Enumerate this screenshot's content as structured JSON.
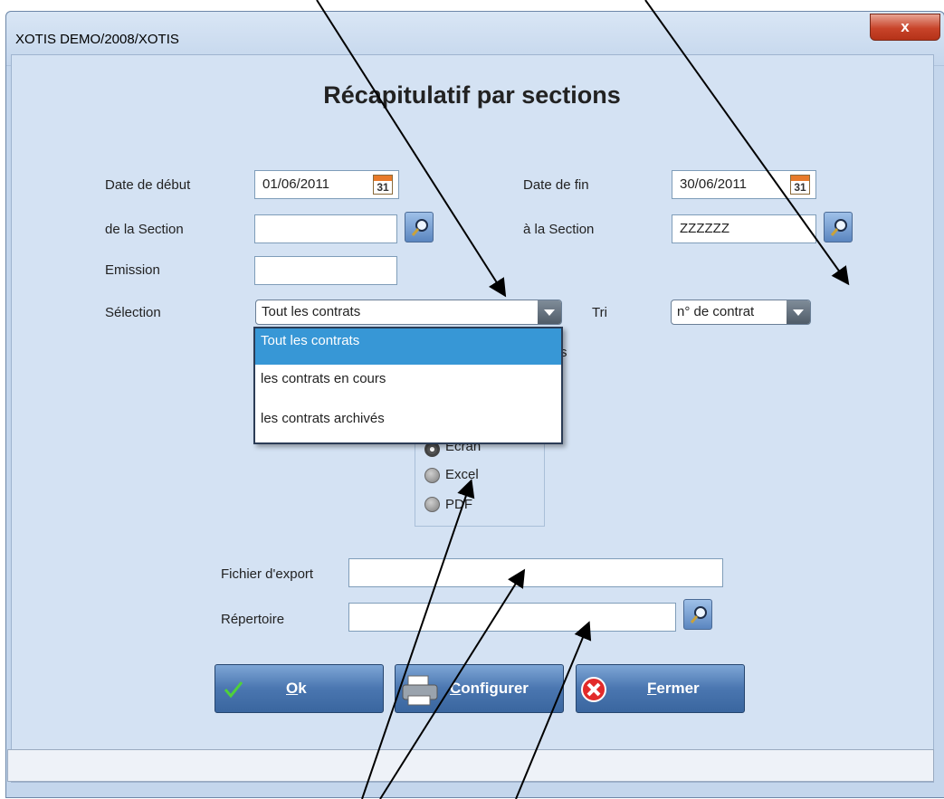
{
  "window": {
    "title": "XOTIS DEMO/2008/XOTIS",
    "close_label": "x"
  },
  "heading": "Récapitulatif par sections",
  "form": {
    "date_debut": {
      "label": "Date de début",
      "value": "01/06/2011",
      "cal_day": "31"
    },
    "date_fin": {
      "label": "Date de fin",
      "value": "30/06/2011",
      "cal_day": "31"
    },
    "section_from": {
      "label": "de la Section",
      "value": ""
    },
    "section_to": {
      "label": "à la Section",
      "value": "ZZZZZZ"
    },
    "emission": {
      "label": "Emission",
      "value": ""
    },
    "selection": {
      "label": "Sélection",
      "value": "Tout les contrats"
    },
    "tri": {
      "label": "Tri",
      "value": "n° de contrat"
    }
  },
  "dropdown": {
    "options": [
      "Tout les contrats",
      "les contrats en cours",
      "les contrats archivés"
    ],
    "selected_index": 0
  },
  "output_options": {
    "partial_visible": "s",
    "radios": [
      {
        "label": "Ecran",
        "checked": true
      },
      {
        "label": "Excel",
        "checked": false
      },
      {
        "label": "PDF",
        "checked": false
      }
    ]
  },
  "export": {
    "fichier": {
      "label": "Fichier d'export",
      "value": ""
    },
    "repertoire": {
      "label": "Répertoire",
      "value": ""
    }
  },
  "buttons": {
    "ok": "Ok",
    "configurer": "Configurer",
    "fermer": "Fermer"
  },
  "colors": {
    "dialog_bg": "#d4e2f3",
    "button_blue": "#4a76b0",
    "selected_item": "#3797d6"
  },
  "icons": [
    "calendar-icon",
    "search-icon",
    "check-icon",
    "printer-icon",
    "cancel-icon"
  ]
}
